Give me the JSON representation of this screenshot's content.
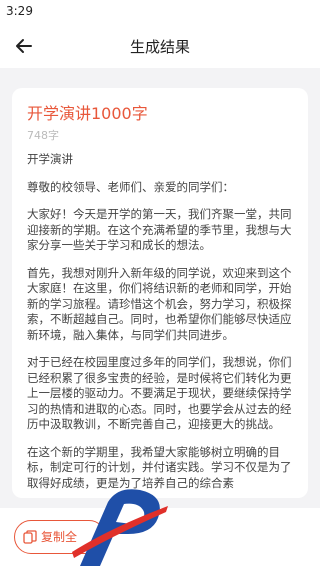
{
  "status_bar": {
    "time": "3:29"
  },
  "header": {
    "title": "生成结果",
    "back_icon": "arrow-left-icon"
  },
  "document": {
    "title": "开学演讲1000字",
    "word_count": "748字",
    "paragraphs": [
      "开学演讲",
      "尊敬的校领导、老师们、亲爱的同学们：",
      "大家好！今天是开学的第一天，我们齐聚一堂，共同迎接新的学期。在这个充满希望的季节里，我想与大家分享一些关于学习和成长的想法。",
      "首先，我想对刚升入新年级的同学说，欢迎来到这个大家庭！在这里，你们将结识新的老师和同学，开始新的学习旅程。请珍惜这个机会，努力学习，积极探索，不断超越自己。同时，也希望你们能够尽快适应新环境，融入集体，与同学们共同进步。",
      "对于已经在校园里度过多年的同学们，我想说，你们已经积累了很多宝贵的经验，是时候将它们转化为更上一层楼的驱动力。不要满足于现状，要继续保持学习的热情和进取的心态。同时，也要学会从过去的经历中汲取教训，不断完善自己，迎接更大的挑战。",
      "在这个新的学期里，我希望大家能够树立明确的目标，制定可行的计划，并付诸实践。学习不仅是为了取得好成绩，更是为了培养自己的综合素"
    ]
  },
  "bottom_bar": {
    "copy_label": "复制全",
    "copy_icon": "copy-icon"
  },
  "colors": {
    "accent": "#e8573a",
    "watermark_blue": "#1f4fa8",
    "watermark_red": "#e0302a"
  }
}
